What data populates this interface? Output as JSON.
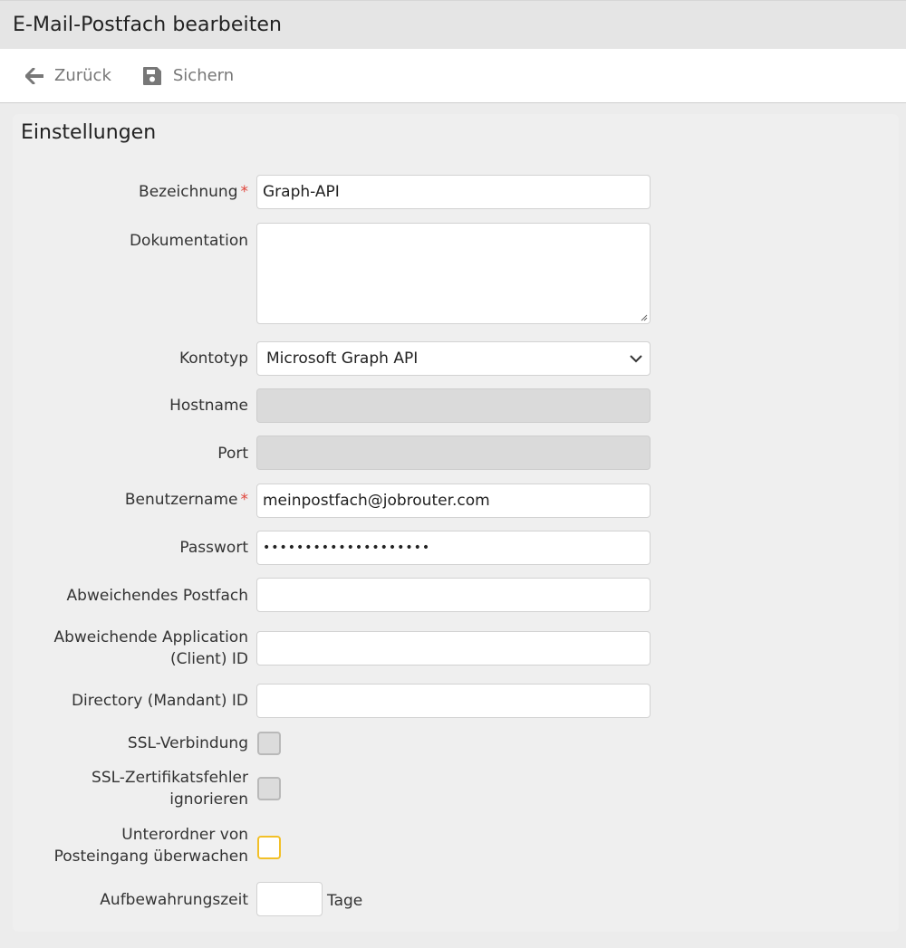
{
  "window": {
    "title": "E-Mail-Postfach bearbeiten"
  },
  "toolbar": {
    "back_label": "Zurück",
    "save_label": "Sichern"
  },
  "panel": {
    "title": "Einstellungen"
  },
  "form": {
    "bezeichnung": {
      "label": "Bezeichnung",
      "required": "*",
      "value": "Graph-API"
    },
    "dokumentation": {
      "label": "Dokumentation",
      "value": ""
    },
    "kontotyp": {
      "label": "Kontotyp",
      "value": "Microsoft Graph API"
    },
    "hostname": {
      "label": "Hostname",
      "value": ""
    },
    "port": {
      "label": "Port",
      "value": ""
    },
    "benutzername": {
      "label": "Benutzername",
      "required": "*",
      "value": "meinpostfach@jobrouter.com"
    },
    "passwort": {
      "label": "Passwort",
      "value": "••••••••••••••••••••"
    },
    "abweichendes_postfach": {
      "label": "Abweichendes Postfach",
      "value": ""
    },
    "application_id": {
      "label_line1": "Abweichende Application",
      "label_line2": "(Client) ID",
      "value": ""
    },
    "directory_id": {
      "label": "Directory (Mandant) ID",
      "value": ""
    },
    "ssl": {
      "label": "SSL-Verbindung",
      "checked": false
    },
    "ssl_ignore": {
      "label_line1": "SSL-Zertifikatsfehler",
      "label_line2": "ignorieren",
      "checked": false
    },
    "subfolders": {
      "label_line1": "Unterordner von",
      "label_line2": "Posteingang überwachen",
      "checked": false
    },
    "retention": {
      "label": "Aufbewahrungszeit",
      "value": "",
      "unit": "Tage"
    }
  },
  "colors": {
    "required": "#e0443a",
    "focus_border": "#f2c028",
    "panel_bg": "#efefef"
  }
}
